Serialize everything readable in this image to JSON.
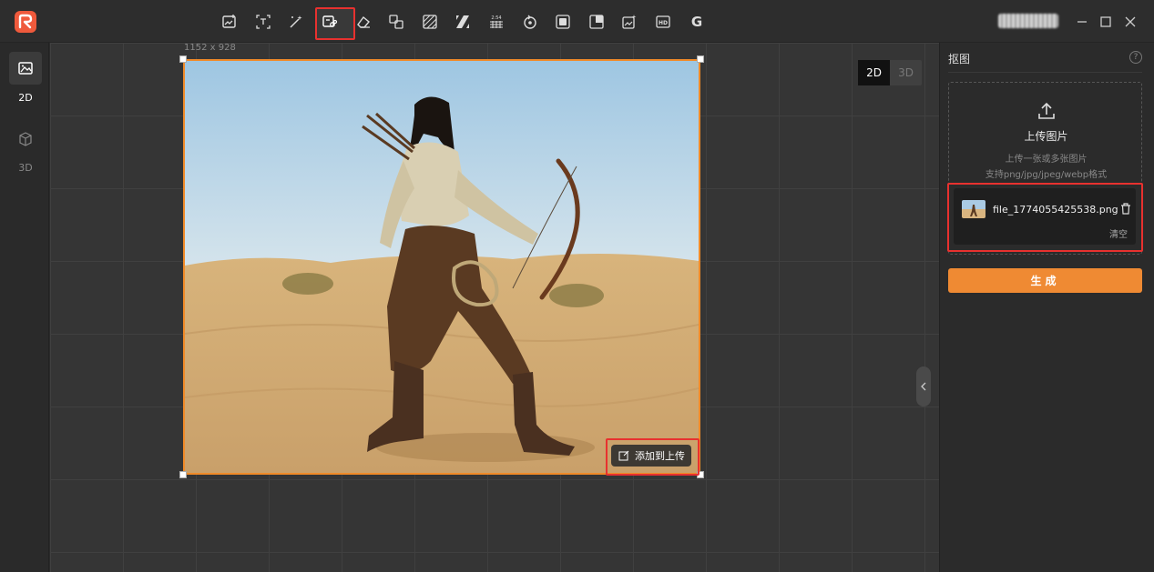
{
  "toolbar": {
    "tools": [
      {
        "name": "image-edit-icon"
      },
      {
        "name": "text-recognize-icon"
      },
      {
        "name": "magic-wand-icon"
      },
      {
        "name": "cutout-icon",
        "active": true
      },
      {
        "name": "eraser-icon"
      },
      {
        "name": "replace-icon"
      },
      {
        "name": "texture-icon"
      },
      {
        "name": "stripes-icon"
      },
      {
        "name": "aspect-ratio-icon",
        "label": "2:54"
      },
      {
        "name": "rotate-view-icon"
      },
      {
        "name": "layers-icon"
      },
      {
        "name": "crop-icon"
      },
      {
        "name": "image-sparkle-icon"
      },
      {
        "name": "hd-icon",
        "label": "HD"
      },
      {
        "name": "g-logo-icon",
        "label": "G"
      }
    ]
  },
  "sidebar": {
    "items": [
      {
        "label": "2D",
        "icon": "image-icon",
        "active": true
      },
      {
        "label": "3D",
        "icon": "cube-icon",
        "active": false
      }
    ]
  },
  "canvas": {
    "dimensions": "1152 x 928",
    "mode_2d": "2D",
    "mode_3d": "3D",
    "add_to_upload": "添加到上传"
  },
  "panel": {
    "title": "抠图",
    "help": "?",
    "upload_title": "上传图片",
    "upload_hint_1": "上传一张或多张图片",
    "upload_hint_2": "支持png/jpg/jpeg/webp格式",
    "file_name": "file_1774055425538.png",
    "clear": "清空",
    "generate": "生成"
  },
  "colors": {
    "accent": "#ef8a33",
    "highlight": "#e8312f",
    "frame": "#f08a28"
  }
}
